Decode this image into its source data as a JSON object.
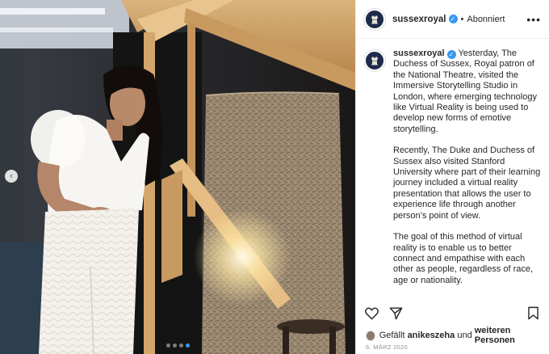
{
  "post": {
    "username": "sussexroyal",
    "verified": true,
    "follow_separator": "•",
    "follow_status": "Abonniert",
    "more_label": "•••",
    "caption_paragraphs": [
      "Yesterday, The Duchess of Sussex, Royal patron of the National Theatre, visited the Immersive Storytelling Studio in London, where emerging technology like Virtual Reality is being used to develop new forms of emotive storytelling.",
      "Recently, The Duke and Duchess of Sussex also visited Stanford University where part of their learning journey included a virtual reality presentation that allows the user to experience life through another person’s point of view.",
      "The goal of this method of virtual reality is to enable us to better connect and empathise with each other as people, regardless of race, age or nationality."
    ],
    "likes": {
      "prefix": "Gefällt",
      "user": "anikeszeha",
      "connector": "und",
      "others": "weiteren Personen"
    },
    "date": "6. MÄRZ 2020"
  },
  "carousel": {
    "prev_icon": "chevron-left-icon",
    "prev_glyph": "‹",
    "slide_count": 4,
    "active_index": 3
  },
  "icons": {
    "like": "heart-outline-icon",
    "share": "paper-plane-icon",
    "save": "bookmark-icon",
    "avatar": "royal-crest-icon"
  },
  "colors": {
    "accent_blue": "#3897f0",
    "text": "#262626",
    "muted": "#8e8e8e",
    "avatar_bg": "#1d2a4a"
  }
}
